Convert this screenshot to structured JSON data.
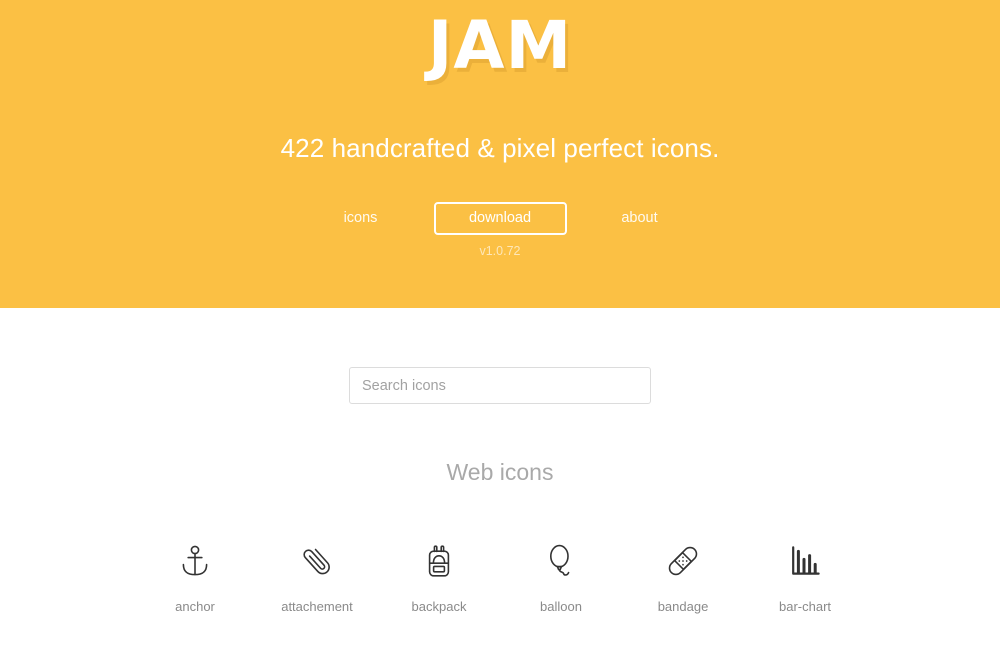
{
  "hero": {
    "logo": "JAM",
    "tagline": "422 handcrafted & pixel perfect icons.",
    "nav": {
      "icons_label": "icons",
      "download_label": "download",
      "about_label": "about"
    },
    "version": "v1.0.72",
    "background_color": "#fbc044",
    "text_color": "#ffffff"
  },
  "search": {
    "value": "",
    "placeholder": "Search icons"
  },
  "section": {
    "title": "Web icons"
  },
  "icons": [
    {
      "name": "anchor",
      "label": "anchor"
    },
    {
      "name": "attachement",
      "label": "attachement"
    },
    {
      "name": "backpack",
      "label": "backpack"
    },
    {
      "name": "balloon",
      "label": "balloon"
    },
    {
      "name": "bandage",
      "label": "bandage"
    },
    {
      "name": "bar-chart",
      "label": "bar-chart"
    }
  ]
}
